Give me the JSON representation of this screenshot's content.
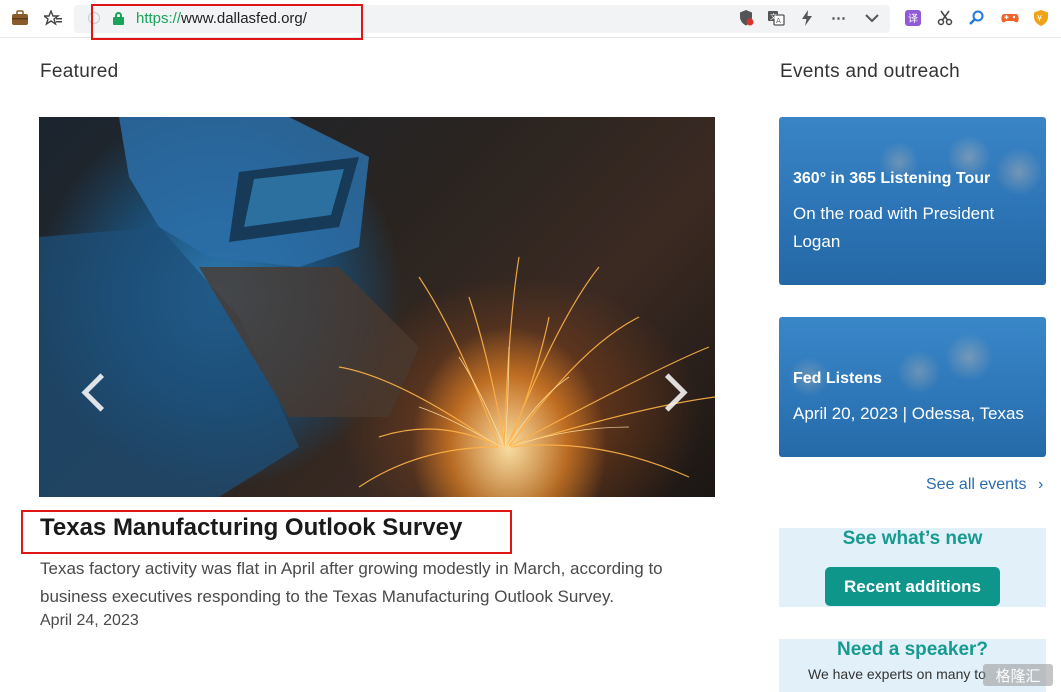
{
  "browser": {
    "url_scheme": "https://",
    "url_host": "www.dallasfed.org/",
    "icons": [
      "briefcase-icon",
      "favorites-icon",
      "lock-icon",
      "shield-icon",
      "translate-icon",
      "lightning-icon",
      "more-icon",
      "chevron-down-icon",
      "translate-ext-icon",
      "scissors-icon",
      "search-icon",
      "game-controller-icon",
      "shield-ext-icon"
    ]
  },
  "featured": {
    "heading": "Featured",
    "article": {
      "title": "Texas Manufacturing Outlook Survey",
      "summary": "Texas factory activity was flat in April after growing modestly in March, according to business executives responding to the Texas Manufacturing Outlook Survey.",
      "date": "April 24, 2023"
    }
  },
  "events": {
    "heading": "Events and outreach",
    "cards": [
      {
        "title": "360° in 365 Listening Tour",
        "subtitle": "On the road with President Logan"
      },
      {
        "title": "Fed Listens",
        "subtitle": "April 20, 2023 | Odessa, Texas"
      }
    ],
    "see_all": "See all events",
    "see_all_chevron": "›"
  },
  "promos": {
    "whats_new": {
      "heading": "See what’s new",
      "button": "Recent additions"
    },
    "speaker": {
      "heading": "Need a speaker?",
      "text": "We have experts on many to"
    }
  },
  "watermark": "格隆汇",
  "colors": {
    "accent_teal": "#0f968b",
    "link_blue": "#2b6cb0",
    "highlight_red": "#e01515",
    "secure_green": "#1aa35a"
  }
}
